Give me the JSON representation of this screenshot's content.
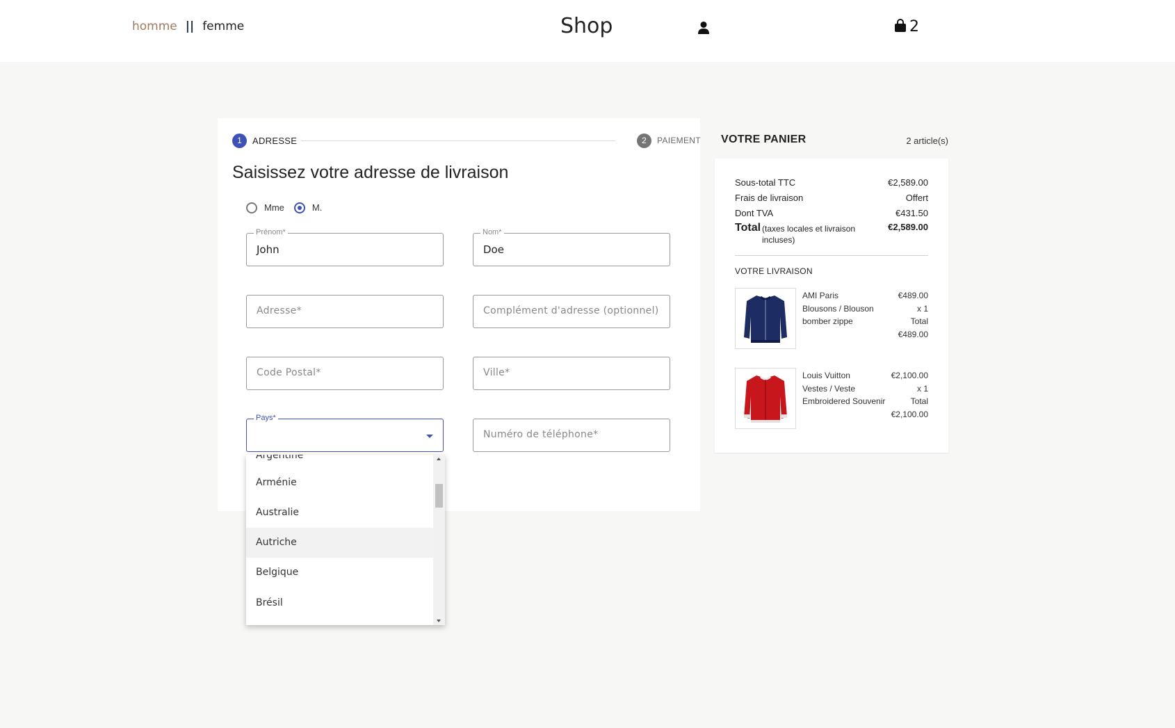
{
  "header": {
    "nav_homme": "homme",
    "nav_separator": "||",
    "nav_femme": "femme",
    "brand": "Shop",
    "cart_count": "2",
    "user_icon": "user-icon",
    "cart_icon": "shopping-bag-icon"
  },
  "stepper": {
    "step1_number": "1",
    "step1_label": "ADRESSE",
    "step2_number": "2",
    "step2_label": "PAIEMENT",
    "active_color": "#3f51b5",
    "inactive_color": "#757575"
  },
  "form": {
    "title": "Saisissez votre adresse de livraison",
    "salutation": {
      "options": [
        "Mme",
        "M."
      ],
      "selected": "M."
    },
    "prenom": {
      "label": "Prénom*",
      "value": "John"
    },
    "nom": {
      "label": "Nom*",
      "value": "Doe"
    },
    "adresse": {
      "placeholder": "Adresse*"
    },
    "complement": {
      "placeholder": "Complément d'adresse (optionnel)"
    },
    "code_postal": {
      "placeholder": "Code Postal*"
    },
    "ville": {
      "placeholder": "Ville*"
    },
    "pays": {
      "label": "Pays*",
      "value": ""
    },
    "telephone": {
      "placeholder": "Numéro de téléphone*"
    }
  },
  "country_dropdown": {
    "options": [
      "Argentine",
      "Arménie",
      "Australie",
      "Autriche",
      "Belgique",
      "Brésil"
    ],
    "hovered": "Autriche"
  },
  "cart_summary": {
    "title": "VOTRE PANIER",
    "count_text": "2 article(s)",
    "subtotal_label": "Sous-total TTC",
    "subtotal_value": "€2,589.00",
    "shipping_label": "Frais de livraison",
    "shipping_value": "Offert",
    "vat_label": "Dont TVA",
    "vat_value": "€431.50",
    "total_label": "Total",
    "total_note": "(taxes locales et livraison incluses)",
    "total_value": "€2,589.00",
    "shipping_section_title": "VOTRE LIVRAISON",
    "items": [
      {
        "brand": "AMI Paris",
        "category": "Blousons / Blouson",
        "name": "bomber zippe",
        "price": "€489.00",
        "qty": "x 1",
        "total_label": "Total",
        "total": "€489.00",
        "color": "#1d2c63"
      },
      {
        "brand": "Louis Vuitton",
        "category": "Vestes / Veste",
        "name": "Embroidered Souvenir",
        "price": "€2,100.00",
        "qty": "x 1",
        "total_label": "Total",
        "total": "€2,100.00",
        "color": "#c8161d"
      }
    ]
  }
}
